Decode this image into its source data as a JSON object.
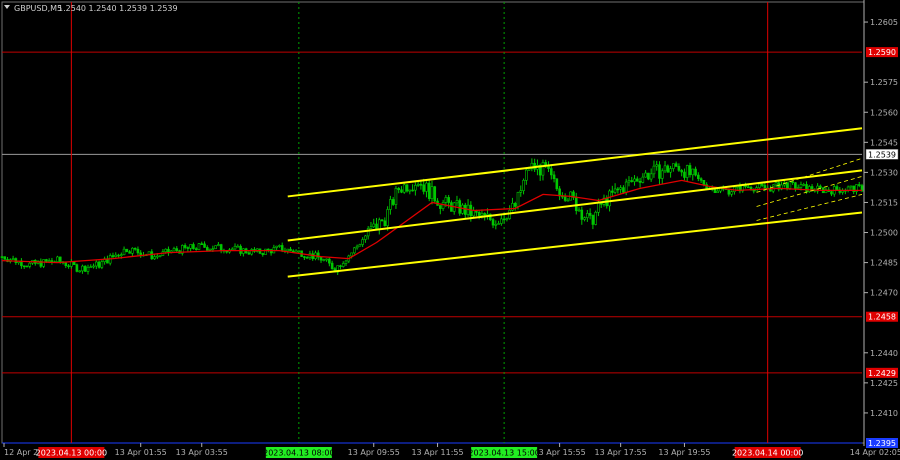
{
  "header": {
    "symbol_tf": "GBPUSD,M5",
    "ohlc": "1.2540 1.2540 1.2539 1.2539"
  },
  "colors": {
    "background": "#000000",
    "candles": "#00c800",
    "ma": "#e00000",
    "channel": "#ffff00",
    "level": "#c00000",
    "date_marker": "#00a000",
    "grid_axis": "#b0b0b0",
    "current_price": "#9a9a9a",
    "bottom_line": "#1a3cff"
  },
  "chart_data": {
    "type": "candlestick",
    "instrument": "GBPUSD",
    "timeframe": "M5",
    "ylim": [
      1.2395,
      1.2615
    ],
    "x_range_bars": [
      0,
      310
    ],
    "y_ticks": [
      1.2605,
      1.2575,
      1.256,
      1.2545,
      1.253,
      1.2515,
      1.25,
      1.2485,
      1.247,
      1.244,
      1.2425,
      1.241
    ],
    "x_ticks": [
      {
        "label": "12 Apr 2023",
        "bar": 0
      },
      {
        "label": "13 Apr 01:55",
        "bar": 50
      },
      {
        "label": "13 Apr 03:55",
        "bar": 72
      },
      {
        "label": "13 Apr 09:55",
        "bar": 134
      },
      {
        "label": "13 Apr 11:55",
        "bar": 157
      },
      {
        "label": "13 Apr 15:55",
        "bar": 201
      },
      {
        "label": "13 Apr 17:55",
        "bar": 223
      },
      {
        "label": "13 Apr 19:55",
        "bar": 246
      },
      {
        "label": "14 Apr 02:05",
        "bar": 315
      }
    ],
    "price_levels": [
      {
        "price": 1.259,
        "label": "1.2590"
      },
      {
        "price": 1.2458,
        "label": "1.2458"
      },
      {
        "price": 1.243,
        "label": "1.2429"
      },
      {
        "price": 1.2395,
        "label": "1.2395"
      }
    ],
    "current_price": {
      "price": 1.2539,
      "label": "1.2539"
    },
    "vertical_markers": [
      {
        "bar": 25,
        "label": "2023.04.13 00:00",
        "kind": "day",
        "color": "#e00000"
      },
      {
        "bar": 107,
        "label": "2023.04.13 08:00",
        "kind": "session",
        "color": "#00a000"
      },
      {
        "bar": 181,
        "label": "2023.04.13 15:00",
        "kind": "session",
        "color": "#00a000"
      },
      {
        "bar": 276,
        "label": "2023.04.14 00:00",
        "kind": "day",
        "color": "#e00000"
      }
    ],
    "close_path": [
      [
        0,
        1.2488
      ],
      [
        10,
        1.2484
      ],
      [
        20,
        1.2486
      ],
      [
        28,
        1.2482
      ],
      [
        35,
        1.2484
      ],
      [
        45,
        1.2492
      ],
      [
        55,
        1.2488
      ],
      [
        62,
        1.2491
      ],
      [
        72,
        1.2493
      ],
      [
        82,
        1.2492
      ],
      [
        92,
        1.249
      ],
      [
        100,
        1.2492
      ],
      [
        108,
        1.249
      ],
      [
        115,
        1.2487
      ],
      [
        120,
        1.2482
      ],
      [
        126,
        1.249
      ],
      [
        132,
        1.25
      ],
      [
        138,
        1.2507
      ],
      [
        143,
        1.2522
      ],
      [
        150,
        1.2526
      ],
      [
        158,
        1.2515
      ],
      [
        165,
        1.2512
      ],
      [
        172,
        1.2508
      ],
      [
        178,
        1.2506
      ],
      [
        185,
        1.2513
      ],
      [
        190,
        1.2533
      ],
      [
        196,
        1.2531
      ],
      [
        200,
        1.2522
      ],
      [
        204,
        1.2519
      ],
      [
        208,
        1.2512
      ],
      [
        212,
        1.2505
      ],
      [
        216,
        1.2514
      ],
      [
        222,
        1.2521
      ],
      [
        230,
        1.2528
      ],
      [
        238,
        1.2531
      ],
      [
        244,
        1.2533
      ],
      [
        250,
        1.2527
      ],
      [
        256,
        1.2522
      ],
      [
        262,
        1.2521
      ],
      [
        268,
        1.2523
      ],
      [
        276,
        1.2522
      ],
      [
        282,
        1.2524
      ],
      [
        290,
        1.2522
      ],
      [
        298,
        1.2521
      ],
      [
        305,
        1.2522
      ],
      [
        310,
        1.2522
      ]
    ],
    "ma_path": [
      [
        0,
        1.2486
      ],
      [
        20,
        1.2485
      ],
      [
        40,
        1.2487
      ],
      [
        60,
        1.249
      ],
      [
        80,
        1.2491
      ],
      [
        100,
        1.2491
      ],
      [
        115,
        1.2488
      ],
      [
        125,
        1.2487
      ],
      [
        135,
        1.2495
      ],
      [
        145,
        1.2505
      ],
      [
        155,
        1.2515
      ],
      [
        170,
        1.2511
      ],
      [
        185,
        1.2512
      ],
      [
        195,
        1.2519
      ],
      [
        205,
        1.2518
      ],
      [
        215,
        1.2516
      ],
      [
        230,
        1.2522
      ],
      [
        245,
        1.2526
      ],
      [
        255,
        1.2523
      ],
      [
        265,
        1.2521
      ],
      [
        280,
        1.2522
      ],
      [
        295,
        1.2521
      ],
      [
        310,
        1.2521
      ]
    ],
    "trend_channel": [
      {
        "role": "upper",
        "from": [
          103,
          1.2518
        ],
        "to": [
          310,
          1.2552
        ]
      },
      {
        "role": "middle",
        "from": [
          103,
          1.2496
        ],
        "to": [
          310,
          1.2531
        ]
      },
      {
        "role": "lower",
        "from": [
          103,
          1.2478
        ],
        "to": [
          310,
          1.251
        ]
      }
    ],
    "dashed_channel": [
      {
        "from": [
          272,
          1.252
        ],
        "to": [
          310,
          1.2537
        ]
      },
      {
        "from": [
          272,
          1.2513
        ],
        "to": [
          310,
          1.2528
        ]
      },
      {
        "from": [
          272,
          1.2506
        ],
        "to": [
          310,
          1.2519
        ]
      }
    ]
  }
}
